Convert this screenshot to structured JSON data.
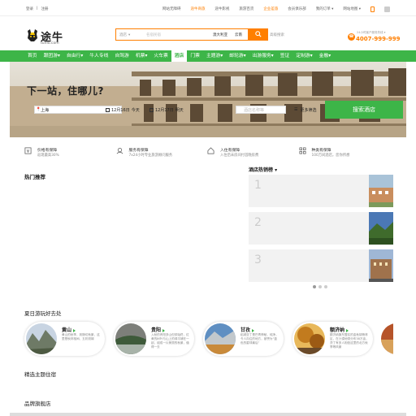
{
  "topbar": {
    "login": "登录",
    "sep": "|",
    "register": "注册",
    "links": [
      "网站无障碍",
      "途牛商旅",
      "途牛影视",
      "旅游百货",
      "企业差旅",
      "会员俱乐部",
      "我的订单 ▾",
      "网站地图 ▾"
    ],
    "highlight_indices": [
      1,
      4
    ]
  },
  "header": {
    "logo_name": "途牛",
    "logo_domain": "tuniu.com",
    "search_select": "酒店",
    "search_placeholder": "名宿民宿",
    "search_tags": [
      "澳大利亚",
      "云南"
    ],
    "advanced": "高级搜索",
    "phone_label": "24小时客户服务热线 ▾",
    "phone_number": "4007-999-999"
  },
  "nav": {
    "items": [
      "首页",
      "跟团游▾",
      "自由行▾",
      "牛人专线",
      "自驾游",
      "机票▾",
      "火车票",
      "酒店",
      "门票",
      "主题游▾",
      "邮轮游▾",
      "出游服务▾",
      "签证",
      "定制游▾",
      "金融▾"
    ],
    "active_index": 7
  },
  "hero": {
    "title": "下一站，住哪儿?",
    "city": "上海",
    "checkin": "12月16日",
    "checkin_day": "今天",
    "checkout": "12月17日",
    "checkout_day": "明天",
    "keyword_placeholder": "酒店名称等",
    "filter": "更多筛选",
    "search_button": "搜索酒店"
  },
  "guarantees": [
    {
      "title": "价格有保障",
      "desc": "返现最高30%",
      "icon": "price-icon"
    },
    {
      "title": "服务有保障",
      "desc": "7x24小时专业旅游顾问服务",
      "icon": "service-icon"
    },
    {
      "title": "入住有保障",
      "desc": "入住后未房间付首晚房费",
      "icon": "checkin-icon"
    },
    {
      "title": "种类有保障",
      "desc": "100万间酒店，您你所想",
      "icon": "variety-icon"
    }
  ],
  "sections": {
    "hot": "热门推荐",
    "rank": "酒店热销榜 ▾",
    "summer": "夏日游玩好去处",
    "theme": "精选主题住宿",
    "brand": "品牌旗舰店"
  },
  "rank_items": [
    "1",
    "2",
    "3"
  ],
  "destinations": [
    {
      "name": "黄山",
      "desc": "黄山的秋季，到随切秋景，这里是秋林相间、五彩斑斓"
    },
    {
      "name": "贵阳",
      "desc": "入秋的贵阳多山但却始终，红黄的树叶与山上的绿平铺在一起，组成一片美丽的秋景，值得一去"
    },
    {
      "name": "甘孜",
      "desc": "稻城亚丁是巴青神秘、纯净，令人向往的地方，被誉为“蓝色的星球最后”"
    },
    {
      "name": "额济纳",
      "desc": "额济纳旗东盟名的金秋胡杨林区，在沙漠地带分布38万亩，茨丁有多人相信这里的北方秋季等风景"
    }
  ],
  "colors": {
    "accent": "#ff7f00",
    "green": "#3db548"
  }
}
